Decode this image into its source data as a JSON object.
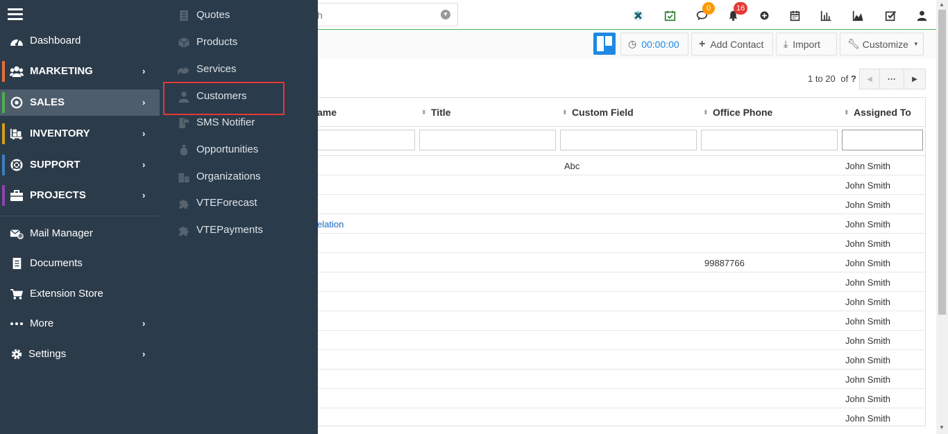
{
  "search": {
    "text": "h"
  },
  "notifications": {
    "chat_count": "0",
    "bell_count": "16"
  },
  "toolbar": {
    "timer": "00:00:00",
    "add_contact": "Add Contact",
    "import": "Import",
    "customize": "Customize"
  },
  "pager": {
    "range": "1 to 20",
    "of_label": "of",
    "total": "?"
  },
  "grid": {
    "columns": [
      "ame",
      "Title",
      "Custom Field",
      "Office Phone",
      "Assigned To"
    ],
    "rows": [
      {
        "name": "",
        "custom": "Abc",
        "phone": "",
        "assigned": "John Smith"
      },
      {
        "name": "",
        "custom": "",
        "phone": "",
        "assigned": "John Smith"
      },
      {
        "name": "",
        "custom": "",
        "phone": "",
        "assigned": "John Smith"
      },
      {
        "name": "elation",
        "custom": "",
        "phone": "",
        "assigned": "John Smith"
      },
      {
        "name": "",
        "custom": "",
        "phone": "",
        "assigned": "John Smith"
      },
      {
        "name": "",
        "custom": "",
        "phone": "99887766",
        "assigned": "John Smith"
      },
      {
        "name": "",
        "custom": "",
        "phone": "",
        "assigned": "John Smith"
      },
      {
        "name": "",
        "custom": "",
        "phone": "",
        "assigned": "John Smith"
      },
      {
        "name": "",
        "custom": "",
        "phone": "",
        "assigned": "John Smith"
      },
      {
        "name": "",
        "custom": "",
        "phone": "",
        "assigned": "John Smith"
      },
      {
        "name": "",
        "custom": "",
        "phone": "",
        "assigned": "John Smith"
      },
      {
        "name": "",
        "custom": "",
        "phone": "",
        "assigned": "John Smith"
      },
      {
        "name": "",
        "custom": "",
        "phone": "",
        "assigned": "John Smith"
      },
      {
        "name": "",
        "custom": "",
        "phone": "",
        "assigned": "John Smith"
      }
    ]
  },
  "sidebar": {
    "items": [
      {
        "label": "Dashboard"
      },
      {
        "label": "MARKETING"
      },
      {
        "label": "SALES"
      },
      {
        "label": "INVENTORY"
      },
      {
        "label": "SUPPORT"
      },
      {
        "label": "PROJECTS"
      },
      {
        "label": "Mail Manager"
      },
      {
        "label": "Documents"
      },
      {
        "label": "Extension Store"
      },
      {
        "label": "More"
      },
      {
        "label": "Settings"
      }
    ],
    "accent_colors": {
      "marketing": "#e8703a",
      "sales": "#4caf50",
      "inventory": "#d4a017",
      "support": "#3f7fbf",
      "projects": "#8e44ad"
    }
  },
  "submenu": {
    "items": [
      {
        "label": "Quotes"
      },
      {
        "label": "Products"
      },
      {
        "label": "Services"
      },
      {
        "label": "Customers"
      },
      {
        "label": "SMS Notifier"
      },
      {
        "label": "Opportunities"
      },
      {
        "label": "Organizations"
      },
      {
        "label": "VTEForecast"
      },
      {
        "label": "VTEPayments"
      }
    ]
  }
}
